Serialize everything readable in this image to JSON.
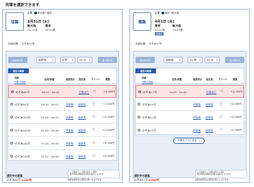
{
  "page_title": "列車を選択できます",
  "outbound": {
    "badge": "往路",
    "segment_label": "区間",
    "route": "新大阪→東京",
    "date": "3月31日 (火)",
    "dep_station": "新大阪",
    "arr_station": "東京",
    "dep_time": "06:12発",
    "arr_time": "08:42着",
    "train_label": "利用列車",
    "train_name": "のぞみ82号",
    "toolbar": {
      "prev": "前の時間帯",
      "next": "後の時間帯",
      "type": "発時刻",
      "hour": "6 時",
      "minute": "00 分"
    },
    "table": {
      "tab": "指定の乗車",
      "headers": {
        "train": "列車",
        "train_detail": "列車の詳細",
        "dep_arr": "出発/到着",
        "seats": "座席表示",
        "reserved": "指定席",
        "green": "グリーン",
        "fare": "運賃"
      },
      "rows": [
        {
          "name": "のぞみ82号",
          "time": "06:12 - 08:42",
          "info": "",
          "reserved": "空席あり",
          "green": "○",
          "fare": "+4,000円",
          "selected": true
        },
        {
          "name": "のぞみ84号",
          "time": "06:30 - 09:01",
          "info": "停車駅",
          "reserved": "座席表",
          "green": "○",
          "fare": "+4,000円",
          "selected": false
        },
        {
          "name": "のぞみ200号",
          "time": "07:00 - 09:27",
          "info": "停車駅",
          "reserved": "座席表",
          "green": "○",
          "fare": "+4,000円",
          "selected": false
        },
        {
          "name": "のぞみ202号",
          "time": "07:09 - 09:36",
          "info": "停車駅",
          "reserved": "座席表",
          "green": "○",
          "fare": "+4,000円",
          "selected": false
        },
        {
          "name": "のぞみ204号",
          "time": "07:18 - 09:45",
          "info": "停車駅",
          "reserved": "座席表",
          "green": "○",
          "fare": "+4,000円",
          "selected": false
        },
        {
          "name": "のぞみ206号",
          "time": "07:27 - 09:54",
          "info": "停車駅",
          "reserved": "座席表",
          "green": "○",
          "fare": "+4,000円",
          "selected": false
        }
      ]
    },
    "legend": [
      "○ 空席あり  △ 空席わずか  × 満席",
      "発売時刻は指定席の発売の扱いによります"
    ],
    "fare_label": "選択中の運賃",
    "fare_value": "のぞみ82号",
    "fare_amount": "4,000円",
    "note": "運賃は時刻表の発売の扱いによります"
  },
  "return": {
    "badge": "復路",
    "segment_label": "区間",
    "route": "東京→新大阪",
    "date": "4月1日 (水)",
    "dep_station": "東京",
    "arr_station": "新大阪",
    "dep_time": "14:05発",
    "arr_time": "14:45着",
    "tag": "変更可",
    "train_label": "利用列車",
    "train_name": "のぞみ17号",
    "toolbar": {
      "prev": "前の時間帯",
      "next": "後の時間帯",
      "type": "発時刻",
      "hour": "14 時",
      "minute": "00 分"
    },
    "table": {
      "tab": "指定の乗車",
      "headers": {
        "train": "列車",
        "train_detail": "列車の詳細",
        "dep_arr": "出発/到着",
        "seats": "座席表示",
        "reserved": "指定席",
        "green": "グリーン",
        "fare": "運賃"
      },
      "rows": [
        {
          "name": "のぞみ17号",
          "time": "14:05 - 14:45",
          "info": "",
          "reserved": "空席あり",
          "green": "○",
          "fare": "+4,000円",
          "selected": true
        },
        {
          "name": "のぞみ19号",
          "time": "",
          "info": "停車駅",
          "reserved": "座席表",
          "green": "○",
          "fare": "+4,000円",
          "selected": false
        },
        {
          "name": "のぞみ21号",
          "time": "",
          "info": "停車駅",
          "reserved": "座席表",
          "green": "○",
          "fare": "+4,000円",
          "selected": false
        },
        {
          "name": "のぞみ23号",
          "time": "",
          "info": "停車駅",
          "reserved": "座席表",
          "green": "○",
          "fare": "+4,000円",
          "selected": false
        }
      ]
    },
    "more_button": "列車をさらに見る",
    "legend": [
      "○ 空席あり  △ 空席わずか  × 満席",
      "発売時刻は指定席の発売の扱いによります"
    ],
    "fare_label": "選択中の運賃",
    "fare_value": "のぞみ17号",
    "fare_amount": "4,000円",
    "note": "運賃は時刻表の発売の扱いによります"
  }
}
